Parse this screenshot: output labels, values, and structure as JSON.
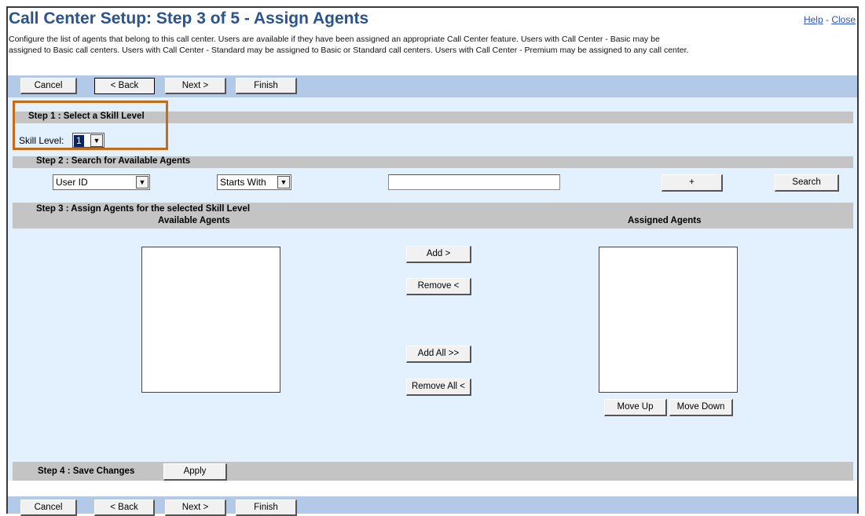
{
  "page": {
    "title": "Call Center Setup: Step 3 of 5 - Assign Agents",
    "help_link": "Help",
    "link_separator": " - ",
    "close_link": "Close",
    "description_line1": "Configure the list of agents that belong to this call center. Users are available if they have been assigned an appropriate Call Center feature. Users with Call Center - Basic may be",
    "description_line2": "assigned to Basic call centers. Users with Call Center - Standard may be assigned to Basic or Standard call centers. Users with Call Center - Premium may be assigned to any call center."
  },
  "toolbar": {
    "cancel_label": "Cancel",
    "back_label": "< Back",
    "next_label": "Next >",
    "finish_label": "Finish"
  },
  "step1": {
    "header": "Step 1 : Select a Skill Level",
    "skill_label": "Skill Level:",
    "skill_value": "1"
  },
  "step2": {
    "header": "Step 2 : Search for Available Agents",
    "field_select": "User ID",
    "mode_select": "Starts With",
    "search_value": "",
    "plus_label": "+",
    "search_label": "Search"
  },
  "step3": {
    "header": "Step 3 : Assign Agents for the selected Skill Level",
    "available_header": "Available Agents",
    "assigned_header": "Assigned Agents",
    "add_label": "Add >",
    "remove_label": "Remove <",
    "add_all_label": "Add All >>",
    "remove_all_label": "Remove All <",
    "move_up_label": "Move Up",
    "move_down_label": "Move Down"
  },
  "step4": {
    "header": "Step 4 : Save Changes",
    "apply_label": "Apply"
  },
  "colors": {
    "title": "#29548f",
    "button_bar": "#b3c9e8",
    "panel": "#e3f0fd",
    "section_header": "#c4c4c4",
    "highlight": "#c46c17"
  }
}
